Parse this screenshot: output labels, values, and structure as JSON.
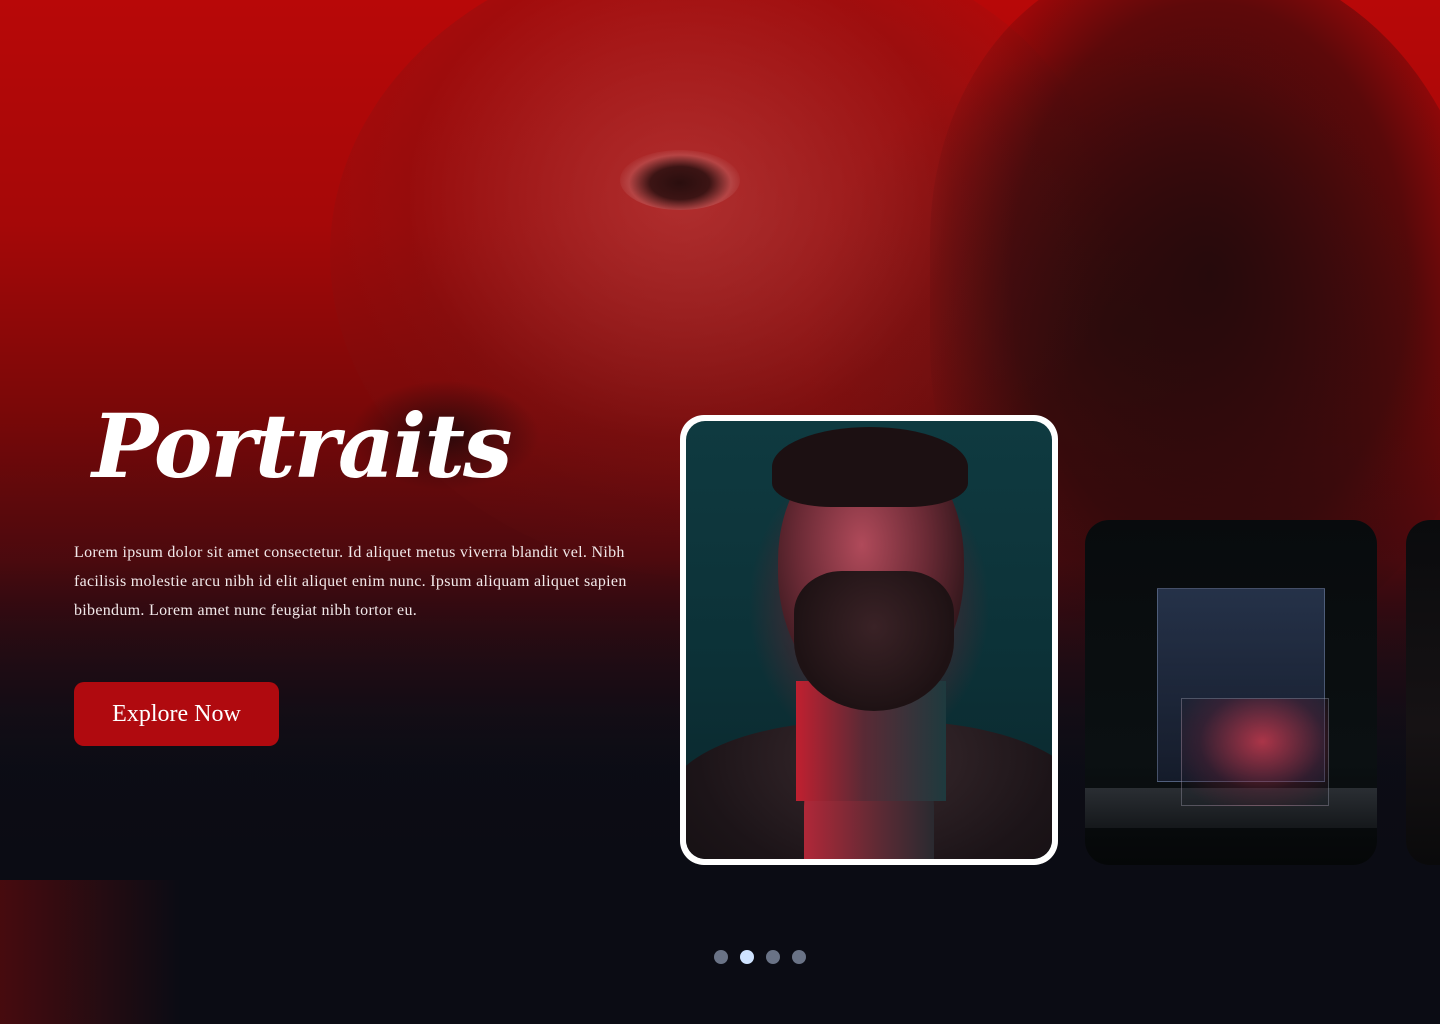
{
  "hero": {
    "title": "Portraits",
    "description": "Lorem ipsum dolor sit amet consectetur. Id aliquet metus viverra blandit vel. Nibh facilisis molestie arcu nibh id elit aliquet enim nunc. Ipsum aliquam aliquet sapien bibendum. Lorem amet nunc feugiat nibh tortor eu.",
    "cta_label": "Explore Now"
  },
  "carousel": {
    "active_index": 1,
    "dot_count": 4
  },
  "colors": {
    "accent": "#b00a0f",
    "background": "#0b0c14",
    "dot_inactive": "#6a7386",
    "dot_active": "#cfe3ff"
  }
}
